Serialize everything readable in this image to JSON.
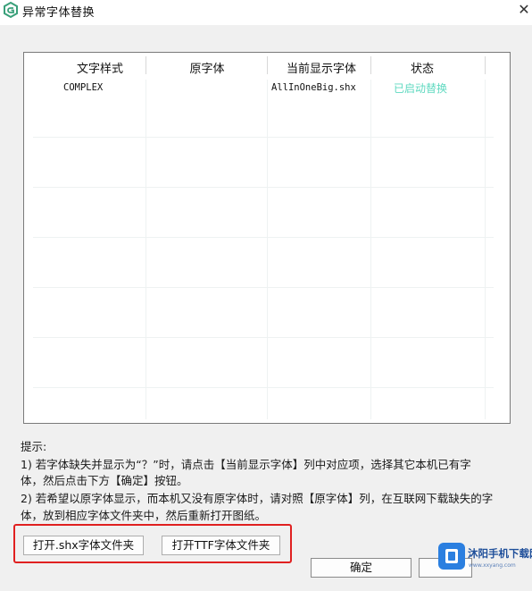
{
  "window": {
    "title": "异常字体替换",
    "close_glyph": "✕"
  },
  "table": {
    "columns": [
      "文字样式",
      "原字体",
      "当前显示字体",
      "状态"
    ],
    "rows": [
      {
        "style": "COMPLEX",
        "original_font": "",
        "display_font": "AllInOneBig.shx",
        "status": "已启动替换"
      }
    ],
    "status_color": "#5fd9c0"
  },
  "hints": {
    "heading": "提示:",
    "line1": "1) 若字体缺失并显示为“？”时，请点击【当前显示字体】列中对应项，选择其它本机已有字",
    "line2": "体，然后点击下方【确定】按钮。",
    "line3": "2) 若希望以原字体显示，而本机又没有原字体时，请对照【原字体】列，在互联网下载缺失的字",
    "line4": "体，放到相应字体文件夹中，然后重新打开图纸。"
  },
  "buttons": {
    "open_shx": "打开.shx字体文件夹",
    "open_ttf": "打开TTF字体文件夹",
    "ok": "确定",
    "cancel": ""
  },
  "watermark": {
    "name": "沐阳手机下载网",
    "url": "www.xxyang.com"
  },
  "colors": {
    "highlight_border": "#e02020",
    "app_icon": "#3aa07a"
  }
}
